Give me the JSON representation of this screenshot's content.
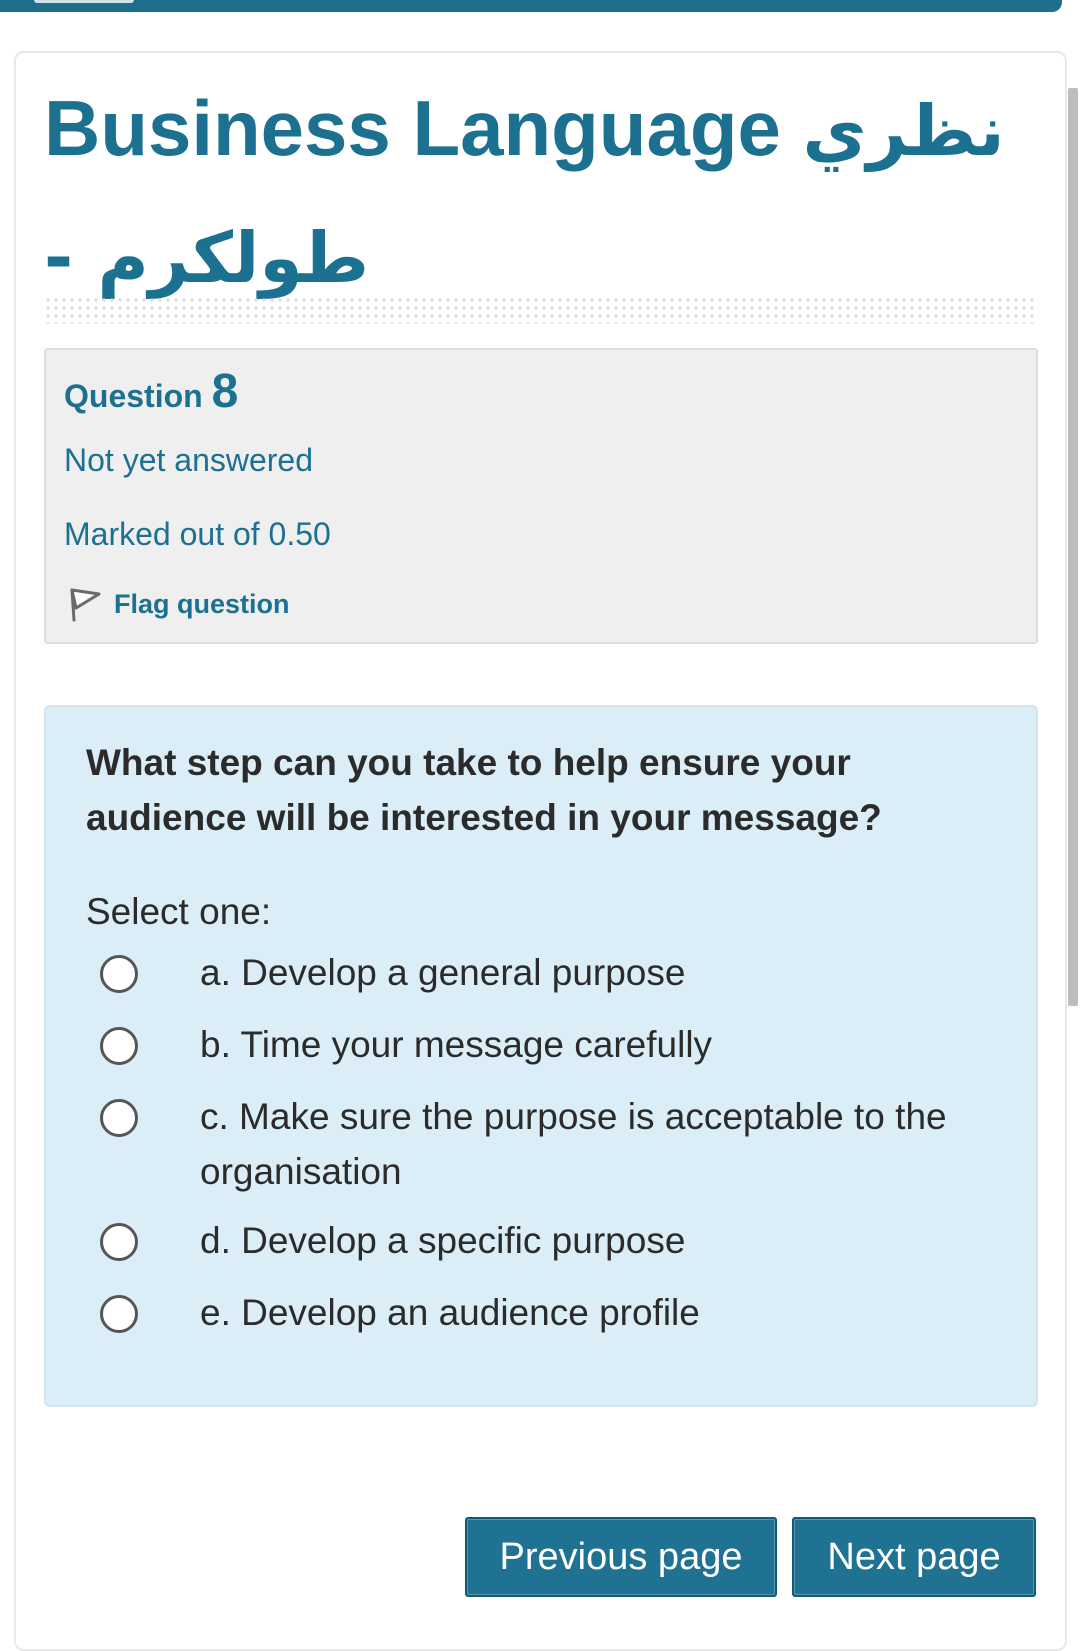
{
  "course": {
    "title_english": "Business Language",
    "title_arabic_line1": "نظري",
    "title_arabic_line2": "- طولكرم"
  },
  "question_info": {
    "label": "Question",
    "number": "8",
    "state": "Not yet answered",
    "grade": "Marked out of 0.50",
    "flag_label": "Flag question"
  },
  "question": {
    "text": "What step can you take to help ensure your audience will be interested in your message?",
    "prompt": "Select one:",
    "options": [
      {
        "label": "a. Develop a general purpose",
        "selected": false
      },
      {
        "label": "b. Time your message carefully",
        "selected": false
      },
      {
        "label": "c. Make sure the purpose is acceptable to the organisation",
        "selected": false
      },
      {
        "label": "d. Develop a specific purpose",
        "selected": false
      },
      {
        "label": "e. Develop an audience profile",
        "selected": false
      }
    ]
  },
  "navigation": {
    "previous_label": "Previous page",
    "next_label": "Next page"
  },
  "colors": {
    "accent": "#1d7190",
    "info_bg": "#efefef",
    "content_bg": "#dbedf6",
    "button_bg": "#1f7291"
  }
}
